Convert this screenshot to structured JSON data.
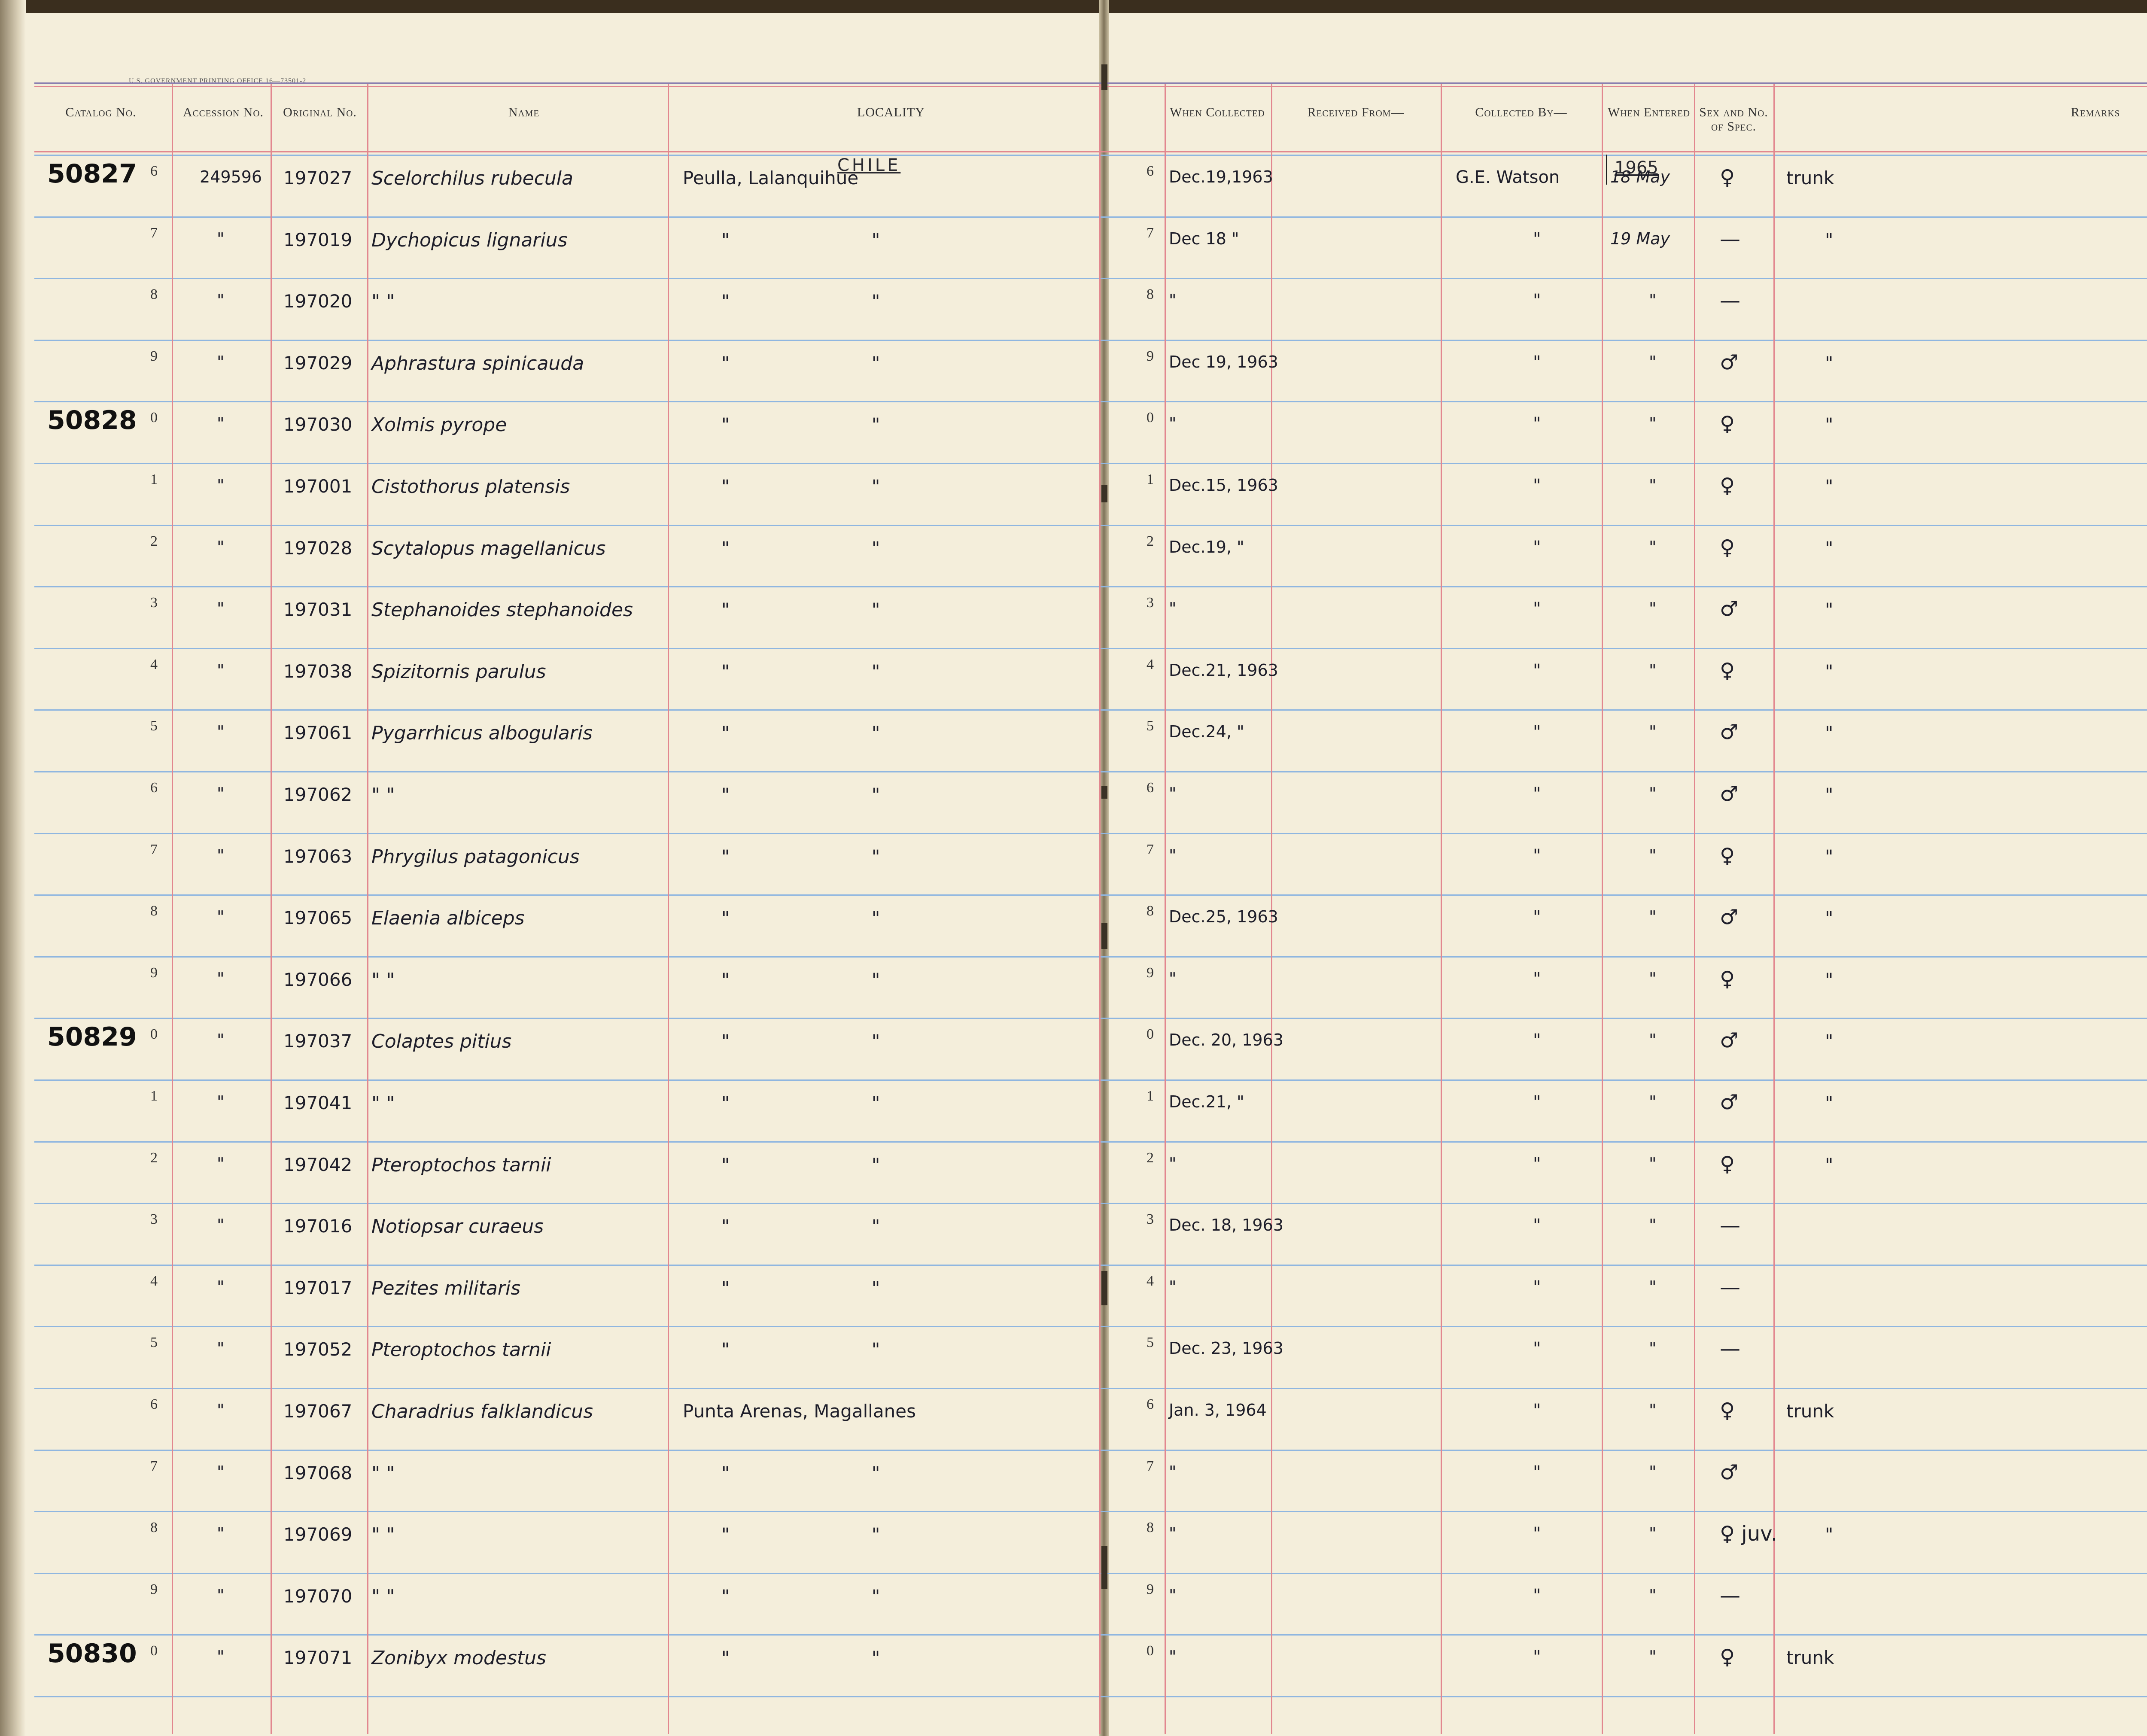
{
  "printer": "U.S. GOVERNMENT PRINTING OFFICE   16—73501-2",
  "headers": {
    "catalog": "Catalog No.",
    "accession": "Accession No.",
    "original": "Original No.",
    "name": "Name",
    "locality": "LOCALITY",
    "when_collected": "When Collected",
    "received_from": "Received From—",
    "collected_by": "Collected By—",
    "when_entered": "When Entered",
    "sex": "Sex and No. of Spec.",
    "remarks": "Remarks"
  },
  "country": "CHILE",
  "year_entered": "1965",
  "colors": {
    "paper": "#f4eedb",
    "blue_rule": "#8fb6e0",
    "red_rule": "#e2878f",
    "ink": "#1e1e2a"
  },
  "rows": [
    {
      "catalog": "50827",
      "digit": "6",
      "accession": "249596",
      "original": "197027",
      "name": "Scelorchilus rubecula",
      "locality": "Peulla, Lalanquihue",
      "locality2": "",
      "rdigit": "6",
      "date": "Dec.19,1963",
      "collected_by": "G.E. Watson",
      "entered": "18 May",
      "sex": "♀",
      "remarks": "trunk"
    },
    {
      "catalog": "",
      "digit": "7",
      "accession": "\"",
      "original": "197019",
      "name": "Dychopicus lignarius",
      "locality": "\"",
      "locality2": "\"",
      "rdigit": "7",
      "date": "Dec 18 \"",
      "collected_by": "\"",
      "entered": "19 May",
      "sex": "—",
      "remarks": "\""
    },
    {
      "catalog": "",
      "digit": "8",
      "accession": "\"",
      "original": "197020",
      "name": "\"        \"",
      "locality": "\"",
      "locality2": "\"",
      "rdigit": "8",
      "date": "\"",
      "collected_by": "\"",
      "entered": "\"",
      "sex": "—",
      "remarks": ""
    },
    {
      "catalog": "",
      "digit": "9",
      "accession": "\"",
      "original": "197029",
      "name": "Aphrastura spinicauda",
      "locality": "\"",
      "locality2": "\"",
      "rdigit": "9",
      "date": "Dec 19, 1963",
      "collected_by": "\"",
      "entered": "\"",
      "sex": "♂",
      "remarks": "\""
    },
    {
      "catalog": "50828",
      "digit": "0",
      "accession": "\"",
      "original": "197030",
      "name": "Xolmis pyrope",
      "locality": "\"",
      "locality2": "\"",
      "rdigit": "0",
      "date": "\"",
      "collected_by": "\"",
      "entered": "\"",
      "sex": "♀",
      "remarks": "\""
    },
    {
      "catalog": "",
      "digit": "1",
      "accession": "\"",
      "original": "197001",
      "name": "Cistothorus platensis",
      "locality": "\"",
      "locality2": "\"",
      "rdigit": "1",
      "date": "Dec.15, 1963",
      "collected_by": "\"",
      "entered": "\"",
      "sex": "♀",
      "remarks": "\""
    },
    {
      "catalog": "",
      "digit": "2",
      "accession": "\"",
      "original": "197028",
      "name": "Scytalopus magellanicus",
      "locality": "\"",
      "locality2": "\"",
      "rdigit": "2",
      "date": "Dec.19, \"",
      "collected_by": "\"",
      "entered": "\"",
      "sex": "♀",
      "remarks": "\""
    },
    {
      "catalog": "",
      "digit": "3",
      "accession": "\"",
      "original": "197031",
      "name": "Stephanoides stephanoides",
      "locality": "\"",
      "locality2": "\"",
      "rdigit": "3",
      "date": "\"",
      "collected_by": "\"",
      "entered": "\"",
      "sex": "♂",
      "remarks": "\""
    },
    {
      "catalog": "",
      "digit": "4",
      "accession": "\"",
      "original": "197038",
      "name": "Spizitornis parulus",
      "locality": "\"",
      "locality2": "\"",
      "rdigit": "4",
      "date": "Dec.21, 1963",
      "collected_by": "\"",
      "entered": "\"",
      "sex": "♀",
      "remarks": "\""
    },
    {
      "catalog": "",
      "digit": "5",
      "accession": "\"",
      "original": "197061",
      "name": "Pygarrhicus albogularis",
      "locality": "\"",
      "locality2": "\"",
      "rdigit": "5",
      "date": "Dec.24, \"",
      "collected_by": "\"",
      "entered": "\"",
      "sex": "♂",
      "remarks": "\""
    },
    {
      "catalog": "",
      "digit": "6",
      "accession": "\"",
      "original": "197062",
      "name": "\"        \"",
      "locality": "\"",
      "locality2": "\"",
      "rdigit": "6",
      "date": "\"",
      "collected_by": "\"",
      "entered": "\"",
      "sex": "♂",
      "remarks": "\""
    },
    {
      "catalog": "",
      "digit": "7",
      "accession": "\"",
      "original": "197063",
      "name": "Phrygilus patagonicus",
      "locality": "\"",
      "locality2": "\"",
      "rdigit": "7",
      "date": "\"",
      "collected_by": "\"",
      "entered": "\"",
      "sex": "♀",
      "remarks": "\""
    },
    {
      "catalog": "",
      "digit": "8",
      "accession": "\"",
      "original": "197065",
      "name": "Elaenia albiceps",
      "locality": "\"",
      "locality2": "\"",
      "rdigit": "8",
      "date": "Dec.25, 1963",
      "collected_by": "\"",
      "entered": "\"",
      "sex": "♂",
      "remarks": "\""
    },
    {
      "catalog": "",
      "digit": "9",
      "accession": "\"",
      "original": "197066",
      "name": "\"        \"",
      "locality": "\"",
      "locality2": "\"",
      "rdigit": "9",
      "date": "\"",
      "collected_by": "\"",
      "entered": "\"",
      "sex": "♀",
      "remarks": "\""
    },
    {
      "catalog": "50829",
      "digit": "0",
      "accession": "\"",
      "original": "197037",
      "name": "Colaptes pitius",
      "locality": "\"",
      "locality2": "\"",
      "rdigit": "0",
      "date": "Dec. 20, 1963",
      "collected_by": "\"",
      "entered": "\"",
      "sex": "♂",
      "remarks": "\""
    },
    {
      "catalog": "",
      "digit": "1",
      "accession": "\"",
      "original": "197041",
      "name": "\"        \"",
      "locality": "\"",
      "locality2": "\"",
      "rdigit": "1",
      "date": "Dec.21, \"",
      "collected_by": "\"",
      "entered": "\"",
      "sex": "♂",
      "remarks": "\""
    },
    {
      "catalog": "",
      "digit": "2",
      "accession": "\"",
      "original": "197042",
      "name": "Pteroptochos tarnii",
      "locality": "\"",
      "locality2": "\"",
      "rdigit": "2",
      "date": "\"",
      "collected_by": "\"",
      "entered": "\"",
      "sex": "♀",
      "remarks": "\""
    },
    {
      "catalog": "",
      "digit": "3",
      "accession": "\"",
      "original": "197016",
      "name": "Notiopsar curaeus",
      "locality": "\"",
      "locality2": "\"",
      "rdigit": "3",
      "date": "Dec. 18, 1963",
      "collected_by": "\"",
      "entered": "\"",
      "sex": "—",
      "remarks": ""
    },
    {
      "catalog": "",
      "digit": "4",
      "accession": "\"",
      "original": "197017",
      "name": "Pezites militaris",
      "locality": "\"",
      "locality2": "\"",
      "rdigit": "4",
      "date": "\"",
      "collected_by": "\"",
      "entered": "\"",
      "sex": "—",
      "remarks": ""
    },
    {
      "catalog": "",
      "digit": "5",
      "accession": "\"",
      "original": "197052",
      "name": "Pteroptochos tarnii",
      "locality": "\"",
      "locality2": "\"",
      "rdigit": "5",
      "date": "Dec. 23, 1963",
      "collected_by": "\"",
      "entered": "\"",
      "sex": "—",
      "remarks": ""
    },
    {
      "catalog": "",
      "digit": "6",
      "accession": "\"",
      "original": "197067",
      "name": "Charadrius falklandicus",
      "locality": "Punta Arenas, Magallanes",
      "locality2": "",
      "rdigit": "6",
      "date": "Jan. 3, 1964",
      "collected_by": "\"",
      "entered": "\"",
      "sex": "♀",
      "remarks": "trunk"
    },
    {
      "catalog": "",
      "digit": "7",
      "accession": "\"",
      "original": "197068",
      "name": "\"        \"",
      "locality": "\"",
      "locality2": "\"",
      "rdigit": "7",
      "date": "\"",
      "collected_by": "\"",
      "entered": "\"",
      "sex": "♂",
      "remarks": ""
    },
    {
      "catalog": "",
      "digit": "8",
      "accession": "\"",
      "original": "197069",
      "name": "\"        \"",
      "locality": "\"",
      "locality2": "\"",
      "rdigit": "8",
      "date": "\"",
      "collected_by": "\"",
      "entered": "\"",
      "sex": "♀ juv.",
      "remarks": "\""
    },
    {
      "catalog": "",
      "digit": "9",
      "accession": "\"",
      "original": "197070",
      "name": "\"        \"",
      "locality": "\"",
      "locality2": "\"",
      "rdigit": "9",
      "date": "\"",
      "collected_by": "\"",
      "entered": "\"",
      "sex": "—",
      "remarks": ""
    },
    {
      "catalog": "50830",
      "digit": "0",
      "accession": "\"",
      "original": "197071",
      "name": "Zonibyx modestus",
      "locality": "\"",
      "locality2": "\"",
      "rdigit": "0",
      "date": "\"",
      "collected_by": "\"",
      "entered": "\"",
      "sex": "♀",
      "remarks": "trunk"
    }
  ]
}
